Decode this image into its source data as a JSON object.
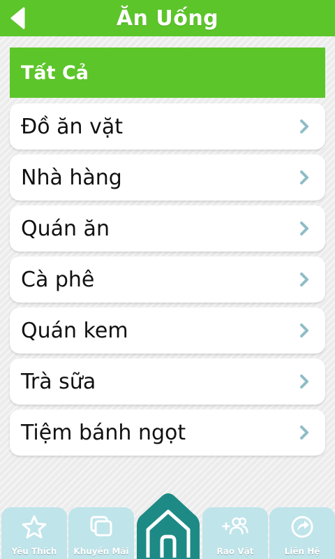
{
  "header": {
    "title": "Ăn Uống",
    "back_icon": "back-arrow-icon",
    "color": "#5cc52a"
  },
  "list": {
    "all_label": "Tất Cả",
    "items": [
      {
        "label": "Đồ ăn vặt"
      },
      {
        "label": "Nhà hàng"
      },
      {
        "label": "Quán ăn"
      },
      {
        "label": "Cà phê"
      },
      {
        "label": "Quán kem"
      },
      {
        "label": "Trà sữa"
      },
      {
        "label": "Tiệm bánh ngọt"
      }
    ],
    "chevron_icon": "chevron-right-icon",
    "chevron_color": "#8fbcc6"
  },
  "tabbar": {
    "tabs": [
      {
        "label": "Yêu Thích",
        "icon": "star-icon"
      },
      {
        "label": "Khuyến Mãi",
        "icon": "cards-icon"
      },
      {
        "label": "",
        "icon": "home-icon"
      },
      {
        "label": "Rao Vặt",
        "icon": "add-users-icon"
      },
      {
        "label": "Liên Hệ",
        "icon": "share-icon"
      }
    ],
    "tab_color": "#bfe4ea",
    "home_color": "#1e8a85"
  }
}
